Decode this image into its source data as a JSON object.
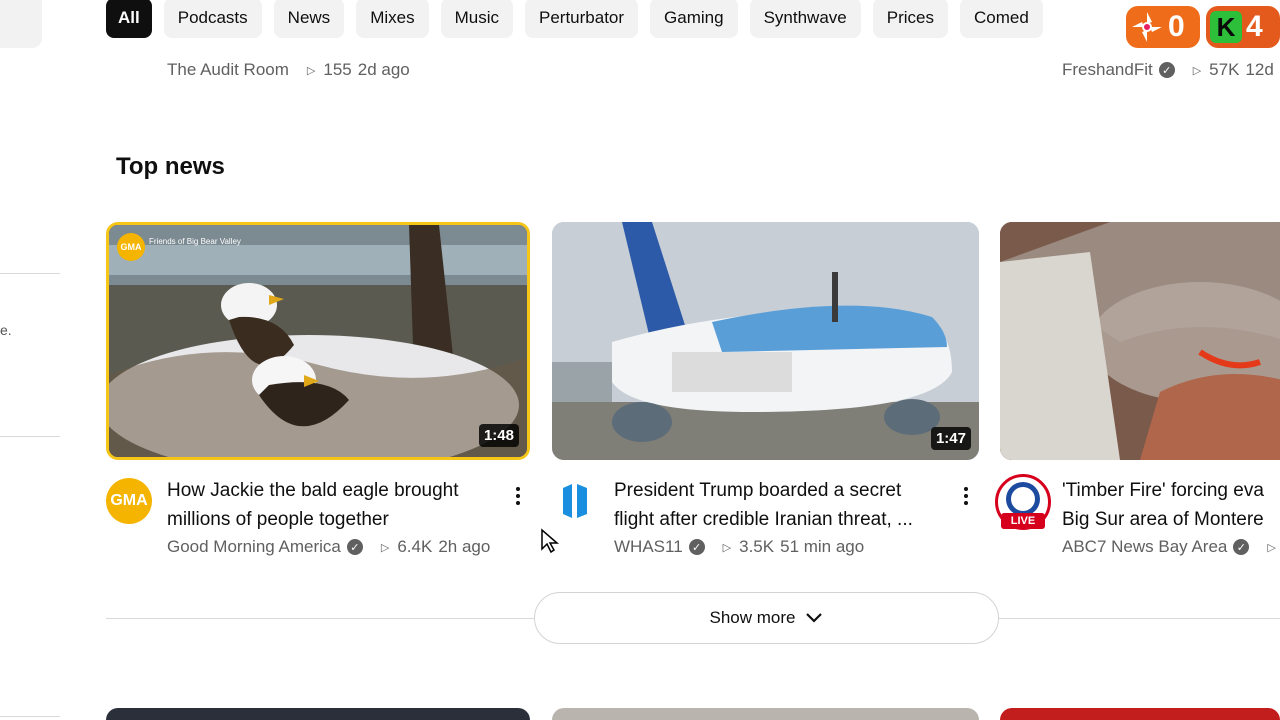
{
  "chips": [
    {
      "label": "All",
      "active": true
    },
    {
      "label": "Podcasts"
    },
    {
      "label": "News"
    },
    {
      "label": "Mixes"
    },
    {
      "label": "Music"
    },
    {
      "label": "Perturbator"
    },
    {
      "label": "Gaming"
    },
    {
      "label": "Synthwave"
    },
    {
      "label": "Prices"
    },
    {
      "label": "Comed"
    }
  ],
  "badges": {
    "counter1": "0",
    "counter2": "4"
  },
  "previous_row": {
    "left": {
      "channel": "The Audit Room",
      "views": "155",
      "age": "2d ago"
    },
    "right": {
      "channel": "FreshandFit",
      "views": "57K",
      "age": "12d"
    }
  },
  "section_title": "Top news",
  "videos": [
    {
      "title_line1": "How Jackie the bald eagle brought",
      "title_line2": "millions of people together",
      "channel": "Good Morning America",
      "views": "6.4K",
      "age": "2h ago",
      "duration": "1:48",
      "avatar_text": "GMA",
      "overlay_text": "Friends of Big Bear Valley"
    },
    {
      "title_line1": "President Trump boarded a secret",
      "title_line2": "flight after credible Iranian threat, ...",
      "channel": "WHAS11",
      "views": "3.5K",
      "age": "51 min ago",
      "duration": "1:47",
      "avatar_text": ""
    },
    {
      "title_line1": "'Timber Fire' forcing eva",
      "title_line2": "Big Sur area of Montere",
      "channel": "ABC7 News Bay Area",
      "views": "",
      "age": "",
      "duration": "",
      "avatar_text": "LIVE"
    }
  ],
  "show_more_label": "Show more",
  "sidebar_fragment": "e."
}
